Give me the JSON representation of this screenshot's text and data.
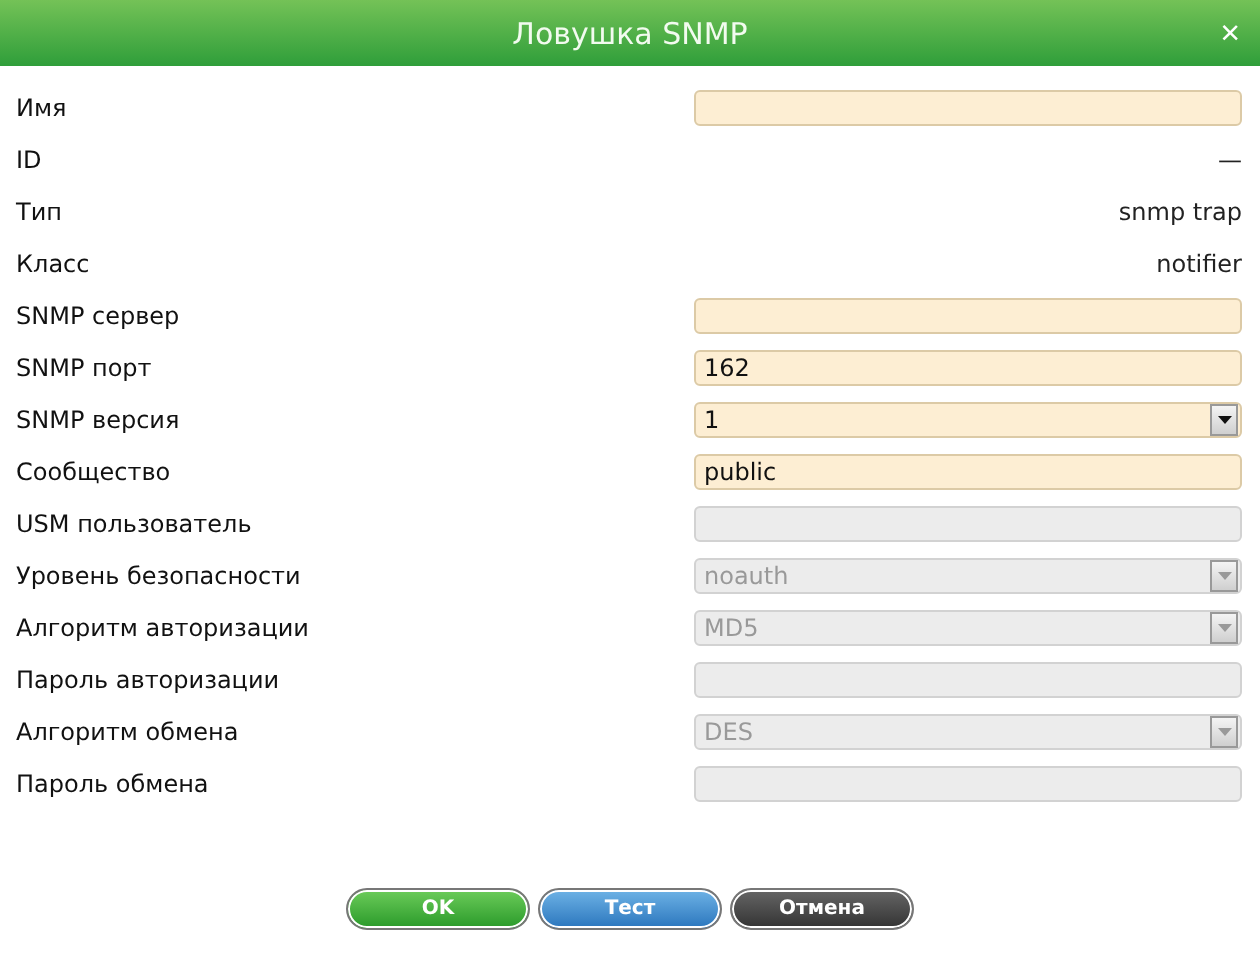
{
  "window": {
    "title": "Ловушка SNMP",
    "close": "×"
  },
  "fields": [
    {
      "label": "Имя",
      "kind": "input",
      "disabled": false
    },
    {
      "label": "ID",
      "kind": "text",
      "value": "—"
    },
    {
      "label": "Тип",
      "kind": "text",
      "value": "snmp trap"
    },
    {
      "label": "Класс",
      "kind": "text",
      "value": "notifier"
    },
    {
      "label": "SNMP сервер",
      "kind": "input",
      "disabled": false
    },
    {
      "label": "SNMP порт",
      "kind": "input",
      "value": "162",
      "disabled": false
    },
    {
      "label": "SNMP версия",
      "kind": "select",
      "value": "1",
      "disabled": false
    },
    {
      "label": "Сообщество",
      "kind": "input",
      "value": "public",
      "disabled": false
    },
    {
      "label": "USM пользователь",
      "kind": "input",
      "disabled": true
    },
    {
      "label": "Уровень безопасности",
      "kind": "select",
      "value": "noauth",
      "disabled": true
    },
    {
      "label": "Алгоритм авторизации",
      "kind": "select",
      "value": "MD5",
      "disabled": true
    },
    {
      "label": "Пароль авторизации",
      "kind": "input",
      "disabled": true
    },
    {
      "label": "Алгоритм обмена",
      "kind": "select",
      "value": "DES",
      "disabled": true
    },
    {
      "label": "Пароль обмена",
      "kind": "input",
      "disabled": true
    }
  ],
  "buttons": [
    {
      "label": "OK",
      "kind": "ok"
    },
    {
      "label": "Тест",
      "kind": "test"
    },
    {
      "label": "Отмена",
      "kind": "cancel"
    }
  ]
}
